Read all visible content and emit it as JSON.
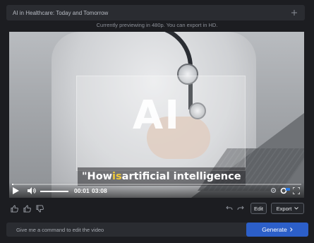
{
  "window": {
    "title": "AI in Healthcare: Today and Tomorrow"
  },
  "preview_note": "Currently previewing in 480p. You can export in HD.",
  "video": {
    "overlay_text": "AI",
    "caption": {
      "before": "\"How ",
      "highlight": "is",
      "after": " artificial intelligence"
    },
    "highlight_color": "#f0c93a",
    "current_time": "00:01",
    "duration": "03:08",
    "progress_fraction": 0.005
  },
  "toolbar": {
    "edit_label": "Edit",
    "export_label": "Export"
  },
  "command": {
    "placeholder": "Give me a command to edit the video",
    "generate_label": "Generate"
  },
  "colors": {
    "accent": "#2c5fc9",
    "background": "#1c1d21"
  },
  "icons": [
    "plus-icon",
    "play-icon",
    "volume-icon",
    "settings-icon",
    "hd-badge-icon",
    "fullscreen-icon",
    "thumbs-up-icon",
    "like-icon",
    "thumbs-down-icon",
    "undo-icon",
    "redo-icon",
    "chevron-down-icon",
    "chevron-right-icon"
  ]
}
